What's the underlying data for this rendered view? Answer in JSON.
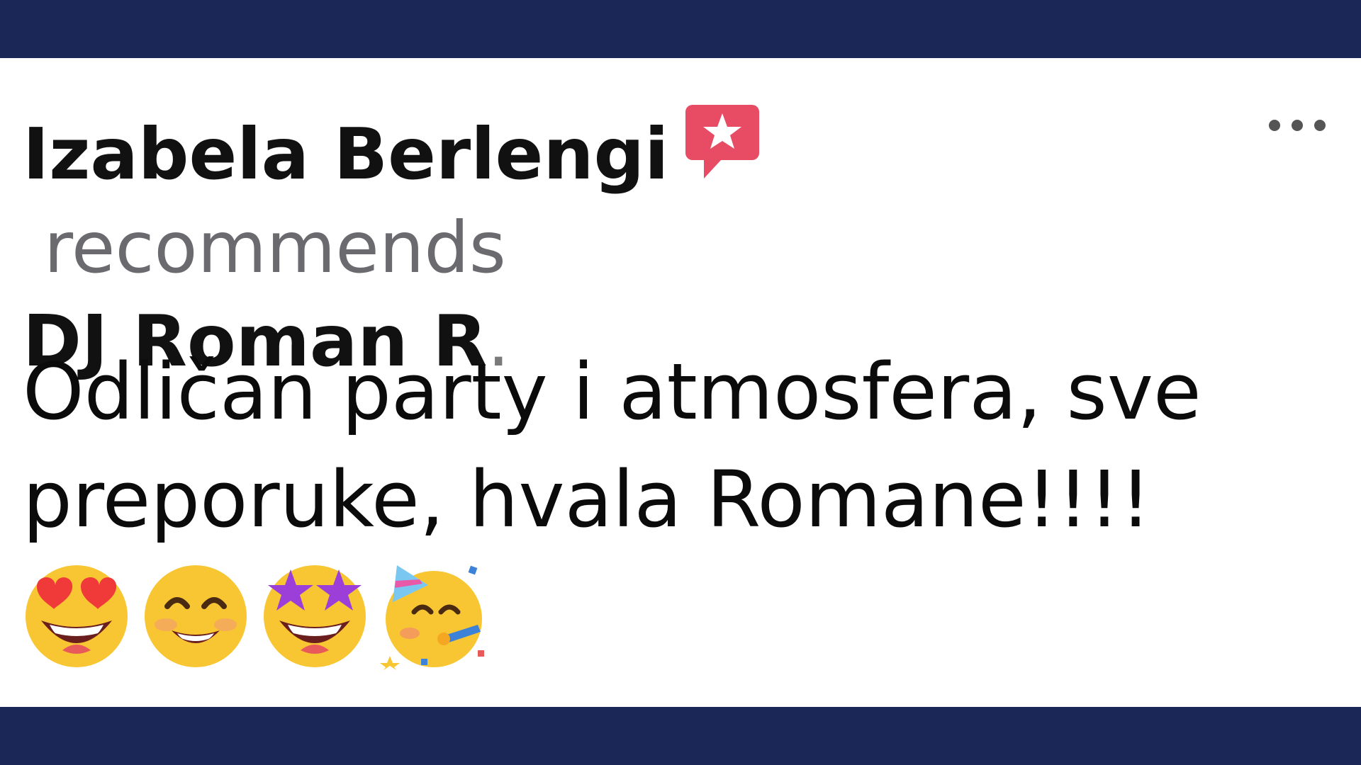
{
  "post": {
    "author": "Izabela Berlengi",
    "action": "recommends",
    "target": "DJ Roman R",
    "target_suffix": ".",
    "review_text": "Odličan party i atmosfera, sve preporuke, hvala Romane!!!!",
    "emojis": [
      "smiling-face-with-heart-eyes-icon",
      "smiling-face-with-smiling-eyes-icon",
      "star-struck-icon",
      "partying-face-icon"
    ]
  },
  "colors": {
    "frame": "#1b2757",
    "badge": "#e74c64",
    "muted_text": "#6b6b6f",
    "emoji_yellow": "#f8c632"
  }
}
